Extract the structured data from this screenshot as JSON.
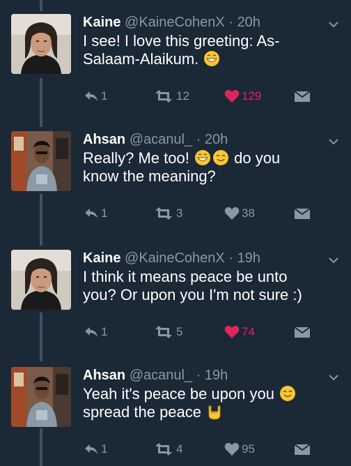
{
  "tweets": [
    {
      "name": "Kaine",
      "handle": "@KaineCohenX",
      "time": "20h",
      "line1": "I see! I love this greeting: As-",
      "line2": "Salaam-Alaikum.",
      "replies": "1",
      "retweets": "12",
      "likes": "129",
      "liked": true
    },
    {
      "name": "Ahsan",
      "handle": "@acanul_",
      "time": "20h",
      "line1a": "Really? Me too!",
      "line1b": "do you",
      "line2": "know the meaning?",
      "replies": "1",
      "retweets": "3",
      "likes": "38",
      "liked": false
    },
    {
      "name": "Kaine",
      "handle": "@KaineCohenX",
      "time": "19h",
      "line1": "I think it means peace be unto",
      "line2": "you? Or upon you I'm not sure :)",
      "replies": "1",
      "retweets": "5",
      "likes": "74",
      "liked": true
    },
    {
      "name": "Ahsan",
      "handle": "@acanul_",
      "time": "19h",
      "line1": "Yeah it's peace be upon you",
      "line2": "spread the peace",
      "replies": "1",
      "retweets": "4",
      "likes": "95",
      "liked": false
    }
  ],
  "separator": "·",
  "icons": {
    "reply": "reply-icon",
    "retweet": "retweet-icon",
    "like": "heart-icon",
    "dm": "envelope-icon",
    "caret": "chevron-down-icon"
  },
  "colors": {
    "background": "#1b2836",
    "secondary_text": "#8899a6",
    "liked": "#e0245e",
    "thread_line": "#3d5466"
  }
}
